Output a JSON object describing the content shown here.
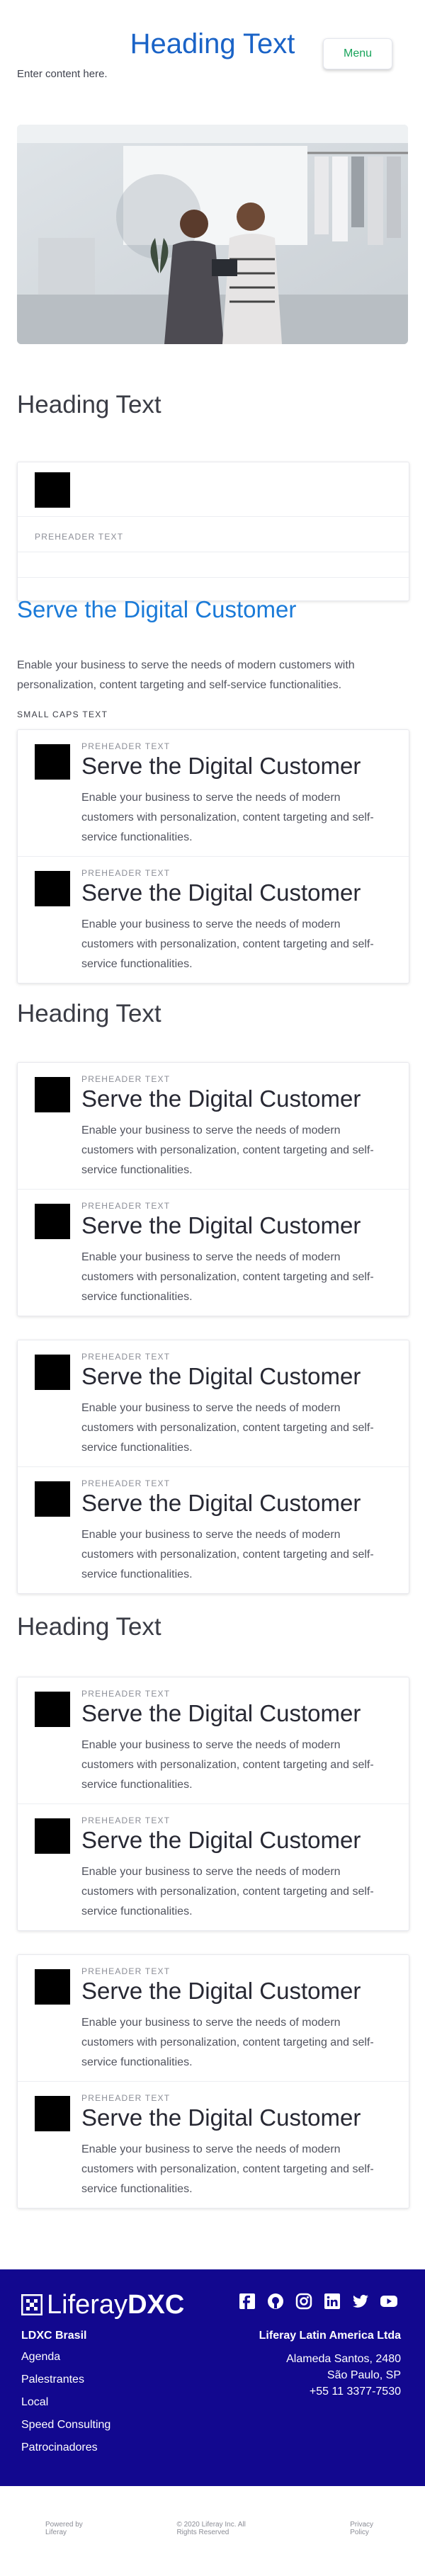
{
  "header": {
    "title": "Heading Text",
    "menu_label": "Menu",
    "subtitle": "Enter content here."
  },
  "section1": {
    "heading": "Heading Text"
  },
  "card1": {
    "preheader": "PREHEADER TEXT"
  },
  "serve": {
    "title": "Serve the Digital Customer",
    "intro": "Enable your business to serve the needs of modern customers with personalization, content targeting and self-service functionalities.",
    "smallcaps": "SMALL CAPS TEXT"
  },
  "section2": {
    "heading": "Heading Text"
  },
  "section3": {
    "heading": "Heading Text"
  },
  "item": {
    "preheader": "PREHEADER TEXT",
    "title": "Serve the Digital Customer",
    "desc": "Enable your business to serve the needs of modern customers with personalization, content targeting and self-service functionalities."
  },
  "footer": {
    "logo_light": "Liferay",
    "logo_bold": "DXC",
    "left_title": "LDXC Brasil",
    "links": [
      "Agenda",
      "Palestrantes",
      "Local",
      "Speed Consulting",
      "Patrocinadores"
    ],
    "right_title": "Liferay Latin America Ltda",
    "address": [
      "Alameda Santos, 2480",
      "São Paulo, SP",
      "+55 11 3377-7530"
    ],
    "social_icons": [
      "facebook-icon",
      "github-icon",
      "instagram-icon",
      "linkedin-icon",
      "twitter-icon",
      "youtube-icon"
    ]
  },
  "bottom": {
    "powered": "Powered by Liferay",
    "copyright": "© 2020 Liferay Inc. All Rights Reserved",
    "privacy": "Privacy Policy"
  },
  "colors": {
    "accent": "#1a63c7",
    "link": "#1a7ad8",
    "menu": "#17a35a",
    "footer_bg": "#12088f"
  }
}
